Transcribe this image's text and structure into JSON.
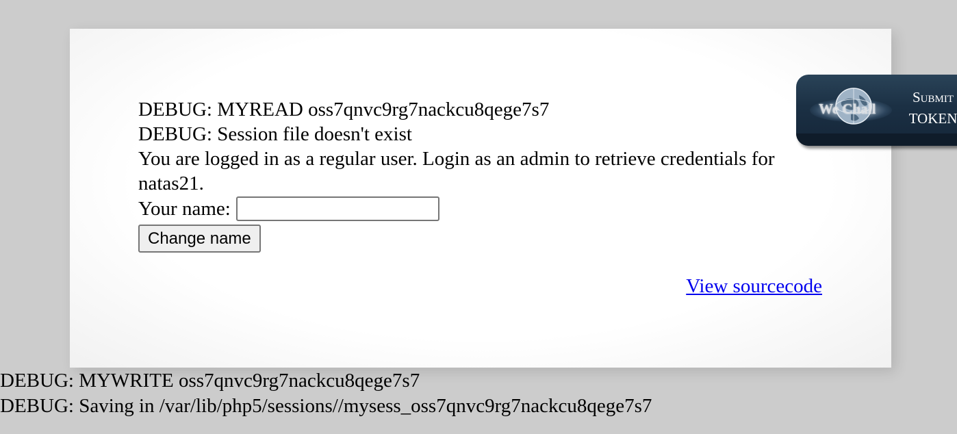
{
  "card": {
    "debug_read": "DEBUG: MYREAD oss7qnvc9rg7nackcu8qege7s7",
    "debug_session": "DEBUG: Session file doesn't exist",
    "message": "You are logged in as a regular user. Login as an admin to retrieve credentials for natas21.",
    "name_label": "Your name:",
    "name_value": "",
    "change_button": "Change name",
    "source_link": "View sourcecode"
  },
  "token_button": {
    "logo_text": "We Chall",
    "submit_word": "Submit",
    "token_word": "TOKEN"
  },
  "footer": {
    "debug_write": "DEBUG: MYWRITE oss7qnvc9rg7nackcu8qege7s7",
    "debug_saving": "DEBUG: Saving in /var/lib/php5/sessions//mysess_oss7qnvc9rg7nackcu8qege7s7"
  },
  "colors": {
    "page_bg": "#cccccc",
    "link": "#0000ee",
    "token_bg": "#1b3044"
  },
  "icons": [
    "globe-icon"
  ]
}
